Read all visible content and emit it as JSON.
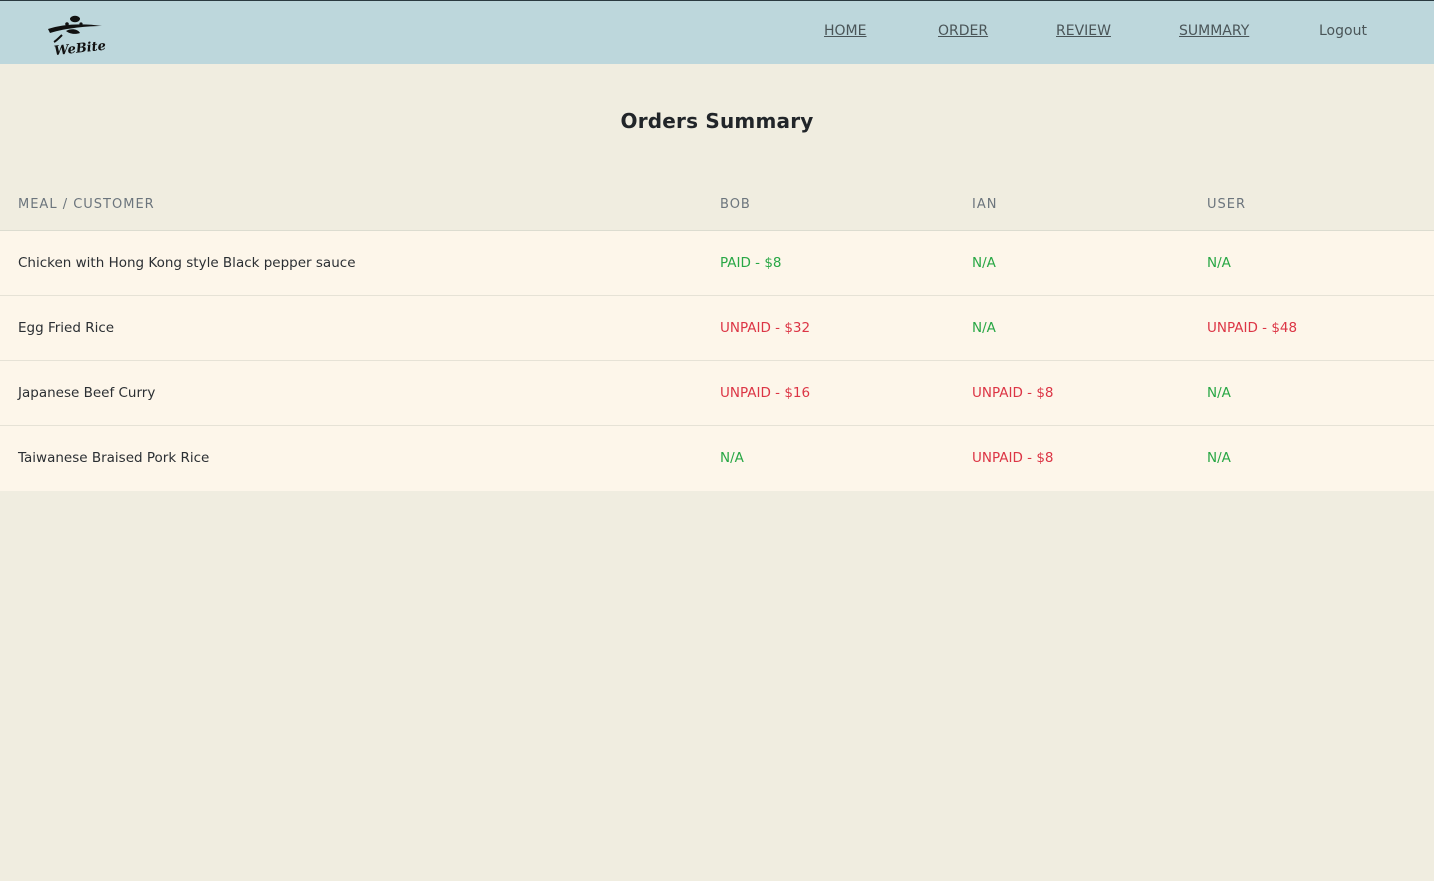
{
  "brand": {
    "name": "WeBite"
  },
  "nav": {
    "home": "HOME",
    "order": "ORDER",
    "review": "REVIEW",
    "summary": "SUMMARY",
    "logout": "Logout"
  },
  "page_title": "Orders Summary",
  "table": {
    "headers": [
      "MEAL / CUSTOMER",
      "BOB",
      "IAN",
      "USER"
    ],
    "rows": [
      {
        "meal": "Chicken with Hong Kong style Black pepper sauce",
        "cells": [
          {
            "text": "PAID - $8",
            "status": "paid"
          },
          {
            "text": "N/A",
            "status": "na"
          },
          {
            "text": "N/A",
            "status": "na"
          }
        ]
      },
      {
        "meal": "Egg Fried Rice",
        "cells": [
          {
            "text": "UNPAID - $32",
            "status": "unpaid"
          },
          {
            "text": "N/A",
            "status": "na"
          },
          {
            "text": "UNPAID - $48",
            "status": "unpaid"
          }
        ]
      },
      {
        "meal": "Japanese Beef Curry",
        "cells": [
          {
            "text": "UNPAID - $16",
            "status": "unpaid"
          },
          {
            "text": "UNPAID - $8",
            "status": "unpaid"
          },
          {
            "text": "N/A",
            "status": "na"
          }
        ]
      },
      {
        "meal": "Taiwanese Braised Pork Rice",
        "cells": [
          {
            "text": "N/A",
            "status": "na"
          },
          {
            "text": "UNPAID - $8",
            "status": "unpaid"
          },
          {
            "text": "N/A",
            "status": "na"
          }
        ]
      }
    ]
  },
  "colors": {
    "navbar": "#bdd7dc",
    "background": "#f0ede0",
    "row": "#fdf6ea",
    "paid": "#28a745",
    "unpaid": "#dc3545"
  }
}
